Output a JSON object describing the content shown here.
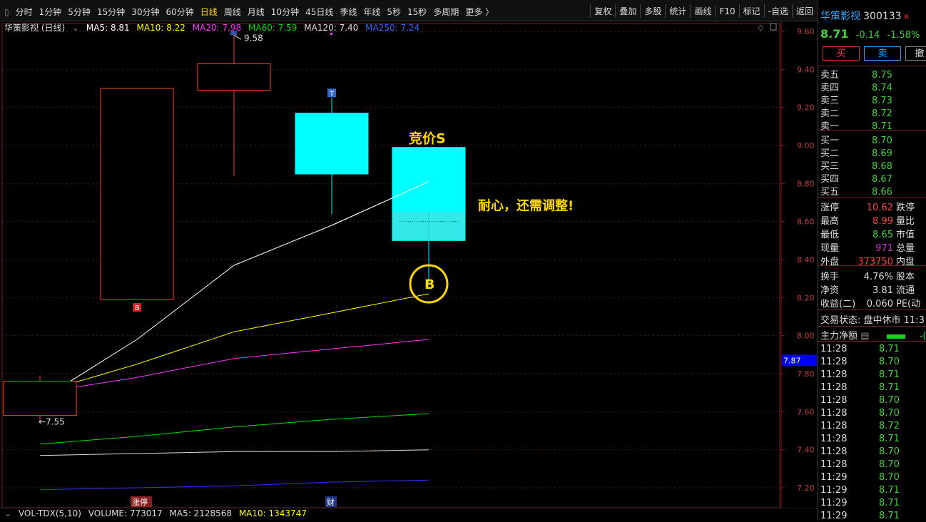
{
  "topbar": {
    "periods": [
      "分时",
      "1分钟",
      "5分钟",
      "15分钟",
      "30分钟",
      "60分钟",
      "日线",
      "周线",
      "月线",
      "10分钟",
      "45日线",
      "季线",
      "年线",
      "5秒",
      "15秒",
      "多周期",
      "更多"
    ],
    "active_period": "日线",
    "right_tools": [
      "复权",
      "叠加",
      "多股",
      "统计",
      "画线",
      "F10",
      "标记",
      "-自选",
      "返回"
    ]
  },
  "legend": {
    "name": "华策影视 (日线)",
    "ma5": "MA5: 8.81",
    "ma10": "MA10: 8.22",
    "ma20": "MA20: 7.98",
    "ma60": "MA60: 7.59",
    "ma120": "MA120: 7.40",
    "ma250": "MA250: 7.24"
  },
  "colors": {
    "ma5": "#ffffff",
    "ma10": "#ffff00",
    "ma20": "#ff33ff",
    "ma60": "#00dd00",
    "ma120": "#dddddd",
    "ma250": "#3333ff",
    "up": "#ff4422",
    "down": "#00ffff",
    "annot": "#ffd700"
  },
  "annotations": {
    "auction_sell": "竞价S",
    "patience": "耐心，还需调整!",
    "buy_circle": "B",
    "high_label": "9.58",
    "low_label": "7.55",
    "marker_b": "B",
    "marker_t": "T",
    "zhangting": "涨停",
    "cai": "财",
    "current_price_tag": "7.87"
  },
  "volume": {
    "title": "VOL-TDX(5,10)",
    "volume": "VOLUME: 773017",
    "ma5": "MA5: 2128568",
    "ma10": "MA10: 1343747"
  },
  "chart_data": {
    "type": "candlestick",
    "ylim": [
      7.12,
      9.68
    ],
    "y_ticks": [
      "9.60",
      "9.40",
      "9.20",
      "9.00",
      "8.80",
      "8.60",
      "8.40",
      "8.20",
      "8.00",
      "7.80",
      "7.60",
      "7.40",
      "7.20"
    ],
    "candles": [
      {
        "open": 7.58,
        "close": 7.76,
        "high": 7.79,
        "low": 7.55
      },
      {
        "open": 8.19,
        "close": 9.3,
        "high": 9.3,
        "low": 8.19
      },
      {
        "open": 9.29,
        "close": 9.43,
        "high": 9.58,
        "low": 8.84
      },
      {
        "open": 9.17,
        "close": 8.85,
        "high": 9.25,
        "low": 8.64
      },
      {
        "open": 8.99,
        "close": 8.5,
        "high": 8.99,
        "low": 8.28
      }
    ],
    "series": [
      {
        "name": "MA5",
        "values": [
          7.66,
          7.98,
          8.37,
          8.58,
          8.81
        ]
      },
      {
        "name": "MA10",
        "values": [
          7.7,
          7.85,
          8.02,
          8.12,
          8.22
        ]
      },
      {
        "name": "MA20",
        "values": [
          7.7,
          7.78,
          7.88,
          7.93,
          7.98
        ]
      },
      {
        "name": "MA60",
        "values": [
          7.43,
          7.47,
          7.52,
          7.56,
          7.59
        ]
      },
      {
        "name": "MA120",
        "values": [
          7.37,
          7.38,
          7.39,
          7.39,
          7.4
        ]
      },
      {
        "name": "MA250",
        "values": [
          7.19,
          7.2,
          7.21,
          7.23,
          7.24
        ]
      }
    ]
  },
  "quote": {
    "name": "华策影视",
    "code": "300133",
    "tag": "R",
    "price": "8.71",
    "change": "-0.14",
    "pct": "-1.58%",
    "buy_btn": "买",
    "sell_btn": "卖",
    "cancel_btn": "撤",
    "asks": [
      {
        "label": "卖五",
        "price": "8.75"
      },
      {
        "label": "卖四",
        "price": "8.74"
      },
      {
        "label": "卖三",
        "price": "8.73"
      },
      {
        "label": "卖二",
        "price": "8.72"
      },
      {
        "label": "卖一",
        "price": "8.71"
      }
    ],
    "bids": [
      {
        "label": "买一",
        "price": "8.70"
      },
      {
        "label": "买二",
        "price": "8.69"
      },
      {
        "label": "买三",
        "price": "8.68"
      },
      {
        "label": "买四",
        "price": "8.67"
      },
      {
        "label": "买五",
        "price": "8.66"
      }
    ],
    "stats": [
      {
        "label": "涨停",
        "value": "10.62",
        "label2": "跌停"
      },
      {
        "label": "最高",
        "value": "8.99",
        "label2": "量比"
      },
      {
        "label": "最低",
        "value": "8.65",
        "label2": "市值"
      },
      {
        "label": "现量",
        "value": "971",
        "label2": "总量"
      },
      {
        "label": "外盘",
        "value": "373750",
        "label2": "内盘"
      }
    ],
    "stats2": [
      {
        "label": "换手",
        "value": "4.76%",
        "label2": "股本"
      },
      {
        "label": "净资",
        "value": "3.81",
        "label2": "流通"
      },
      {
        "label": "收益(二)",
        "value": "0.060",
        "label2": "PE(动"
      }
    ],
    "trade_status": "交易状态: 盘中休市 11:3",
    "main_net": "主力净额",
    "main_net_value": "-(",
    "ticks": [
      {
        "time": "11:28",
        "price": "8.71"
      },
      {
        "time": "11:28",
        "price": "8.70"
      },
      {
        "time": "11:28",
        "price": "8.71"
      },
      {
        "time": "11:28",
        "price": "8.71"
      },
      {
        "time": "11:28",
        "price": "8.70"
      },
      {
        "time": "11:28",
        "price": "8.70"
      },
      {
        "time": "11:28",
        "price": "8.72"
      },
      {
        "time": "11:28",
        "price": "8.71"
      },
      {
        "time": "11:28",
        "price": "8.70"
      },
      {
        "time": "11:28",
        "price": "8.70"
      },
      {
        "time": "11:29",
        "price": "8.70"
      },
      {
        "time": "11:29",
        "price": "8.71"
      },
      {
        "time": "11:29",
        "price": "8.71"
      },
      {
        "time": "11:29",
        "price": "8.71"
      }
    ]
  }
}
